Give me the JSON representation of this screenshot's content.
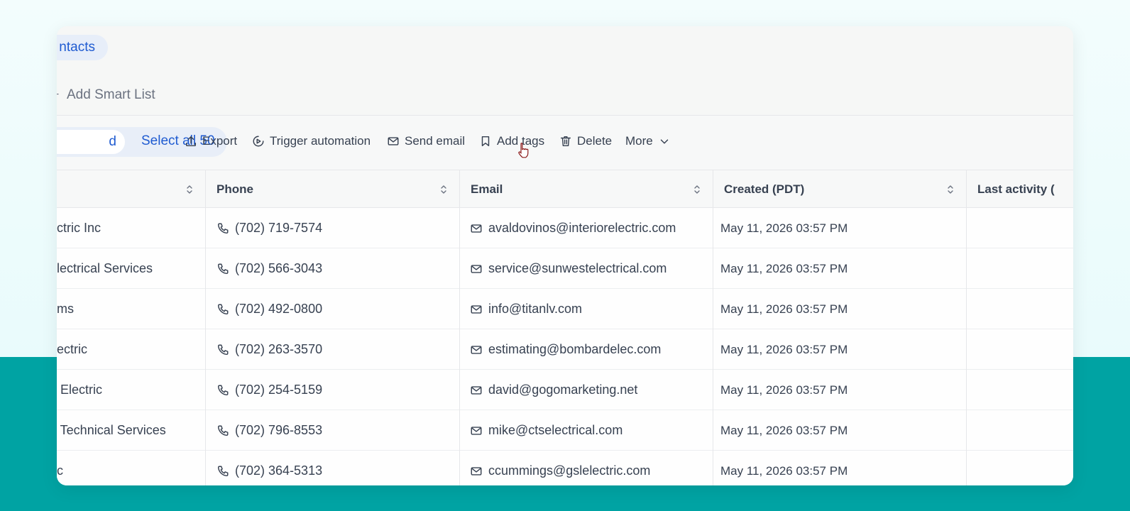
{
  "tab": {
    "label": "ntacts"
  },
  "smart_list": {
    "label": "Add Smart List"
  },
  "toolbar": {
    "selected_label": "d",
    "select_all_label": "Select all 50",
    "export_label": "Export",
    "trigger_label": "Trigger automation",
    "send_email_label": "Send email",
    "add_tags_label": "Add tags",
    "delete_label": "Delete",
    "more_label": "More"
  },
  "table": {
    "headers": {
      "company": "",
      "phone": "Phone",
      "email": "Email",
      "created": "Created (PDT)",
      "last_activity": "Last activity ("
    },
    "rows": [
      {
        "company": "ctric Inc",
        "phone": "(702) 719-7574",
        "email": "avaldovinos@interiorelectric.com",
        "created": "May 11, 2026 03:57 PM"
      },
      {
        "company": "lectrical Services",
        "phone": "(702) 566-3043",
        "email": "service@sunwestelectrical.com",
        "created": "May 11, 2026 03:57 PM"
      },
      {
        "company": "ms",
        "phone": "(702) 492-0800",
        "email": "info@titanlv.com",
        "created": "May 11, 2026 03:57 PM"
      },
      {
        "company": "ectric",
        "phone": "(702) 263-3570",
        "email": "estimating@bombardelec.com",
        "created": "May 11, 2026 03:57 PM"
      },
      {
        "company": " Electric",
        "phone": "(702) 254-5159",
        "email": "david@gogomarketing.net",
        "created": "May 11, 2026 03:57 PM"
      },
      {
        "company": " Technical Services",
        "phone": "(702) 796-8553",
        "email": "mike@ctselectrical.com",
        "created": "May 11, 2026 03:57 PM"
      },
      {
        "company": "c",
        "phone": "(702) 364-5313",
        "email": "ccummings@gslelectric.com",
        "created": "May 11, 2026 03:57 PM"
      }
    ]
  },
  "colors": {
    "accent": "#1f5bd1",
    "teal": "#00a3a3"
  }
}
